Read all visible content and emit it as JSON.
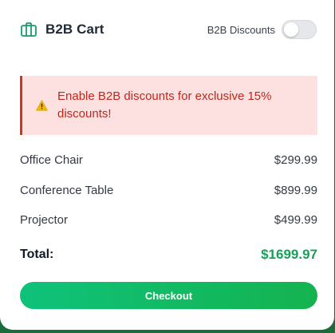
{
  "header": {
    "title": "B2B Cart",
    "icon": "briefcase-icon",
    "accent_color": "#1a9a6b"
  },
  "toggle": {
    "label": "B2B Discounts",
    "enabled": false
  },
  "alert": {
    "icon": "warning-icon",
    "message": "Enable B2B discounts for exclusive 15% discounts!",
    "text_color": "#c0271a",
    "background_color": "#fde1e1",
    "border_color": "#d6331f"
  },
  "cart": {
    "items": [
      {
        "name": "Office Chair",
        "price": "$299.99"
      },
      {
        "name": "Conference Table",
        "price": "$899.99"
      },
      {
        "name": "Projector",
        "price": "$499.99"
      }
    ],
    "total_label": "Total:",
    "total_value": "$1699.97",
    "total_color": "#16a05a"
  },
  "checkout": {
    "label": "Checkout",
    "gradient_start": "#0fc27a",
    "gradient_end": "#14b34f"
  }
}
